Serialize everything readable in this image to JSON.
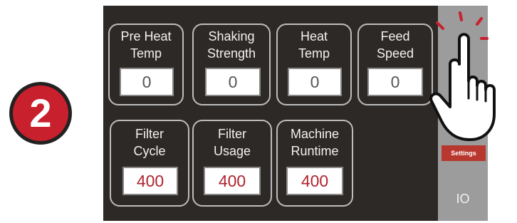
{
  "step": {
    "number": "2"
  },
  "tiles_row1": [
    {
      "label": "Pre Heat\nTemp",
      "value": "0"
    },
    {
      "label": "Shaking\nStrength",
      "value": "0"
    },
    {
      "label": "Heat\nTemp",
      "value": "0"
    },
    {
      "label": "Feed\nSpeed",
      "value": "0"
    }
  ],
  "tiles_row2": [
    {
      "label": "Filter\nCycle",
      "value": "400"
    },
    {
      "label": "Filter\nUsage",
      "value": "400"
    },
    {
      "label": "Machine\nRuntime",
      "value": "400"
    }
  ],
  "sidebar": {
    "settings_label": "Settings",
    "io_label": "IO"
  },
  "colors": {
    "panel": "#2d2926",
    "accent_red": "#c8202d",
    "value_red": "#b0232e",
    "sidebar": "#9c9c9c"
  },
  "icons": {
    "pointer": "hand-pointer-icon"
  }
}
